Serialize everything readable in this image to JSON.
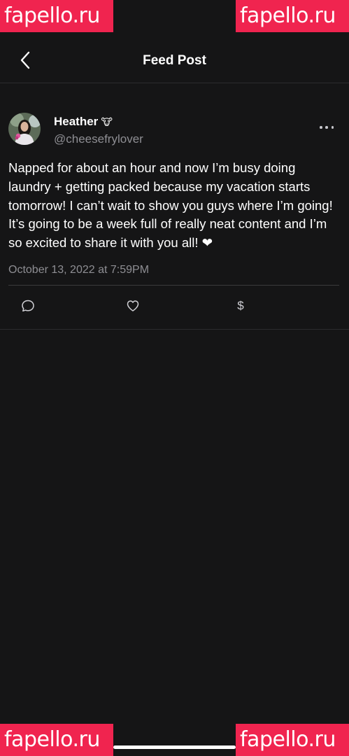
{
  "watermark": {
    "text": "fapello.ru"
  },
  "header": {
    "title": "Feed Post",
    "back_icon": "chevron-left-icon"
  },
  "post": {
    "author": {
      "name": "Heather",
      "emoji": "🐮",
      "handle": "@cheesefrylover"
    },
    "text": "Napped for about an hour and now I’m busy doing laundry + getting packed because my vacation starts tomorrow! I can’t wait to show you guys where I’m going! It’s going to be a week full of really neat content and I’m so excited to share it with you all! ❤",
    "timestamp": "October 13, 2022 at 7:59PM",
    "actions": {
      "comment_icon": "comment-icon",
      "like_icon": "heart-icon",
      "tip_symbol": "$"
    }
  },
  "colors": {
    "background": "#151516",
    "watermark": "#f0244f",
    "secondary_text": "#8e8e93"
  }
}
